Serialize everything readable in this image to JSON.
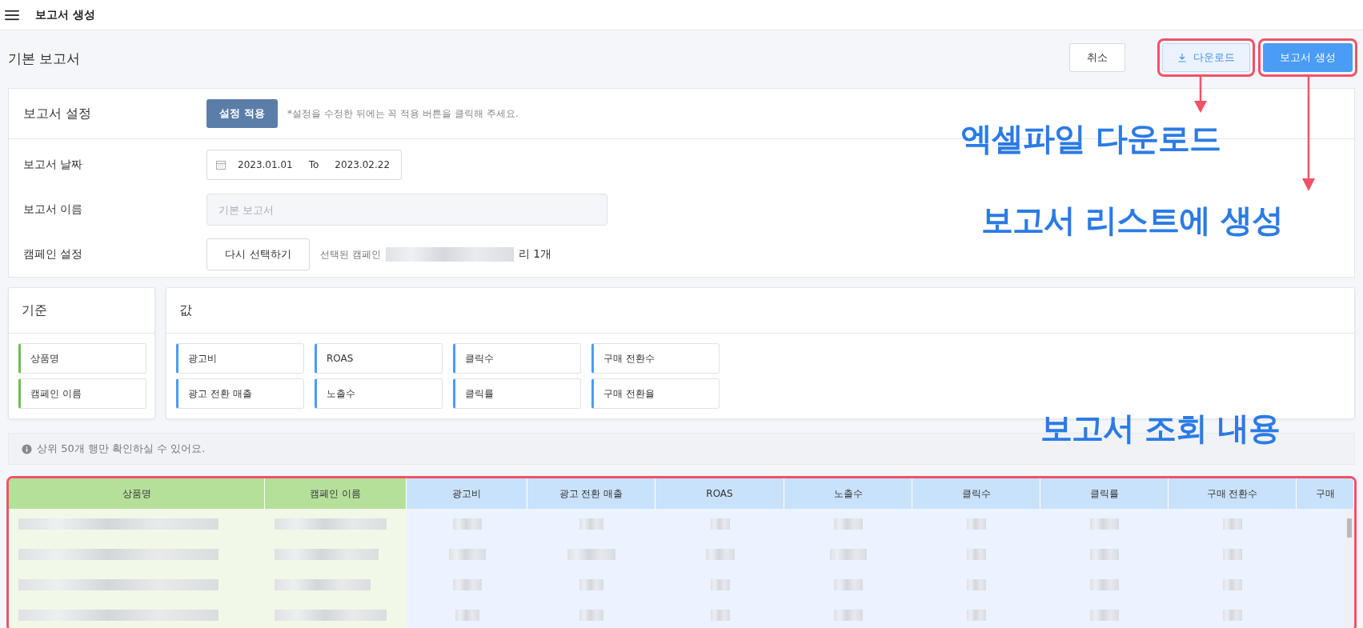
{
  "topbar": {
    "title": "보고서 생성"
  },
  "header": {
    "title": "기본 보고서",
    "buttons": [
      {
        "label": "취소",
        "kind": "default"
      },
      {
        "label": "다운로드",
        "kind": "download"
      },
      {
        "label": "보고서 생성",
        "kind": "create"
      }
    ]
  },
  "settings": {
    "title": "보고서 설정",
    "apply_button": "설정 적용",
    "hint": "*설정을 수정한 뒤에는 꼭 적용 버튼을 클릭해 주세요.",
    "date": {
      "label": "보고서 날짜",
      "from": "2023.01.01",
      "separator": "To",
      "to": "2023.02.22"
    },
    "name": {
      "label": "보고서 이름",
      "placeholder": "기본 보고서"
    },
    "campaign": {
      "label": "캠페인 설정",
      "button": "다시 선택하기",
      "selected_prefix": "선택된 캠페인",
      "selected_suffix": "리 1개"
    }
  },
  "criteria": {
    "title": "기준",
    "items": [
      "상품명",
      "캠페인 이름"
    ]
  },
  "values": {
    "title": "값",
    "items": [
      "광고비",
      "ROAS",
      "클릭수",
      "구매 전환수",
      "광고 전환 매출",
      "노출수",
      "클릭률",
      "구매 전환율"
    ]
  },
  "notice": "상위 50개 행만 확인하실 수 있어요.",
  "table": {
    "highlighted": true,
    "columns": [
      {
        "label": "상품명",
        "kind": "criteria"
      },
      {
        "label": "캠페인 이름",
        "kind": "criteria"
      },
      {
        "label": "광고비",
        "kind": "value"
      },
      {
        "label": "광고 전환 매출",
        "kind": "value"
      },
      {
        "label": "ROAS",
        "kind": "value"
      },
      {
        "label": "노출수",
        "kind": "value"
      },
      {
        "label": "클릭수",
        "kind": "value"
      },
      {
        "label": "클릭률",
        "kind": "value"
      },
      {
        "label": "구매 전환수",
        "kind": "value"
      },
      {
        "label": "구매",
        "kind": "value"
      }
    ]
  },
  "annotations": [
    {
      "text": "엑셀파일 다운로드",
      "kind": "download"
    },
    {
      "text": "보고서 리스트에 생성",
      "kind": "create"
    },
    {
      "text": "보고서 조회 내용",
      "kind": "table"
    }
  ]
}
